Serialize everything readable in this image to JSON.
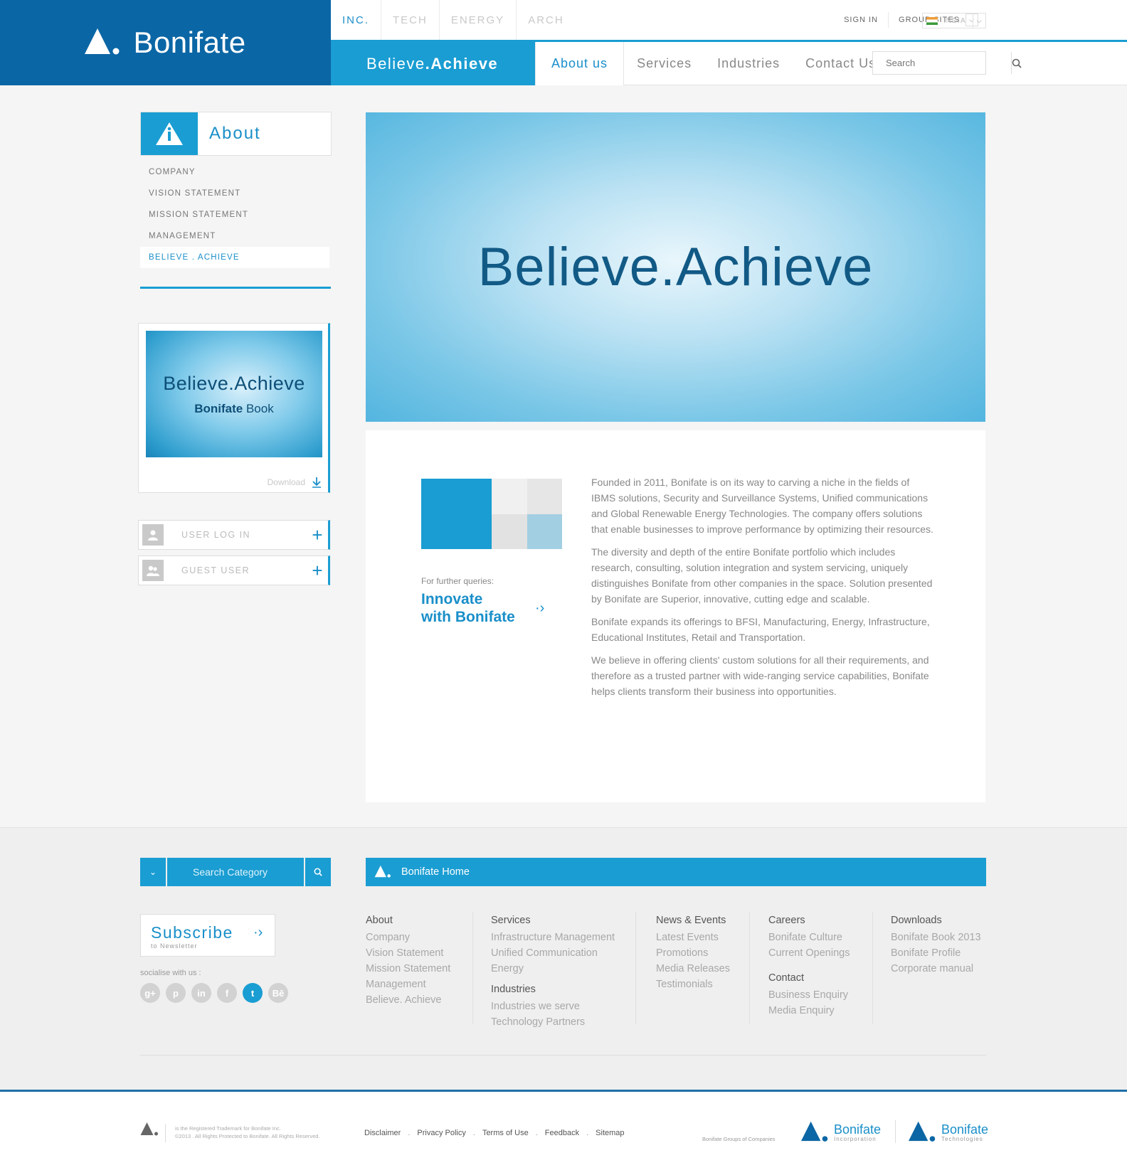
{
  "brand": {
    "name": "Bonifate"
  },
  "top_tabs": [
    "INC.",
    "TECH",
    "ENERGY",
    "ARCH"
  ],
  "util": {
    "sign_in": "SIGN IN",
    "group_sites": "GROUP SITES",
    "country": "INDIA"
  },
  "tagline": {
    "first": "Believe",
    "dot": ".",
    "second": "Achieve"
  },
  "nav": [
    "About us",
    "Services",
    "Industries",
    "Contact Us"
  ],
  "search": {
    "placeholder": "Search"
  },
  "sidebar": {
    "title": "About",
    "items": [
      "COMPANY",
      "VISION STATEMENT",
      "MISSION STATEMENT",
      "MANAGEMENT",
      "BELIEVE . ACHIEVE"
    ],
    "book": {
      "title": "Believe.Achieve",
      "subtitle_bold": "Bonifate",
      "subtitle_rest": " Book",
      "download": "Download"
    },
    "user_login": "USER LOG IN",
    "guest_user": "GUEST USER"
  },
  "hero": {
    "text": "Believe.Achieve"
  },
  "content": {
    "queries_label": "For further queries:",
    "cta_line1": "Innovate",
    "cta_line2": "with Bonifate",
    "paragraphs": [
      "Founded in 2011, Bonifate is on its way to carving a niche in the fields of IBMS solutions, Security and Surveillance Systems, Unified communications and Global Renewable Energy Technologies. The company offers solutions that enable businesses to improve performance by optimizing their resources.",
      "The diversity and depth of the entire Bonifate portfolio which includes research, consulting, solution integration and system servicing, uniquely distinguishes Bonifate from other companies in the space. Solution presented by Bonifate are  Superior, innovative, cutting edge and scalable.",
      "Bonifate expands its offerings to BFSI, Manufacturing, Energy, Infrastructure, Educational Institutes, Retail and Transportation.",
      "We believe in offering clients' custom solutions for all their requirements, and therefore as a trusted partner with wide-ranging service capabilities, Bonifate helps clients transform their business into opportunities."
    ]
  },
  "footer": {
    "search_category": "Search Category",
    "home_bar": "Bonifate Home",
    "subscribe": "Subscribe",
    "subscribe_sub": "to Newsletter",
    "socialise": "socialise with us :",
    "social": [
      "g+",
      "p",
      "in",
      "f",
      "t",
      "Bē"
    ],
    "columns": {
      "about": {
        "heading": "About",
        "links": [
          "Company",
          "Vision Statement",
          "Mission Statement",
          "Management",
          "Believe. Achieve"
        ]
      },
      "services": {
        "heading": "Services",
        "links": [
          "Infrastructure Management",
          "Unified Communication",
          "Energy"
        ]
      },
      "industries": {
        "heading": "Industries",
        "links": [
          "Industries we serve",
          "Technology Partners"
        ]
      },
      "news": {
        "heading": "News & Events",
        "links": [
          "Latest Events",
          "Promotions",
          "Media Releases",
          "Testimonials"
        ]
      },
      "careers": {
        "heading": "Careers",
        "links": [
          "Bonifate Culture",
          "Current Openings"
        ]
      },
      "contact": {
        "heading": "Contact",
        "links": [
          "Business Enquiry",
          "Media Enquiry"
        ]
      },
      "downloads": {
        "heading": "Downloads",
        "links": [
          "Bonifate Book 2013",
          "Bonifate Profile",
          "Corporate manual"
        ]
      }
    },
    "legal_line1": "is the Registered Trademark for Bonifate Inc.",
    "legal_line2": "©2013 . All Rights Protected to Bonifate. All Rights Reserved.",
    "links": [
      "Disclaimer",
      "Privacy Policy",
      "Terms of Use",
      "Feedback",
      "Sitemap"
    ],
    "groups": "Bonifate Groups of Companies",
    "brand1": {
      "name": "Bonifate",
      "sub": "Incorporation"
    },
    "brand2": {
      "name": "Bonifate",
      "sub": "Technologies"
    }
  },
  "colors": {
    "primary_dark": "#0b66a5",
    "accent": "#1a9dd2",
    "link": "#1a8fc9"
  }
}
